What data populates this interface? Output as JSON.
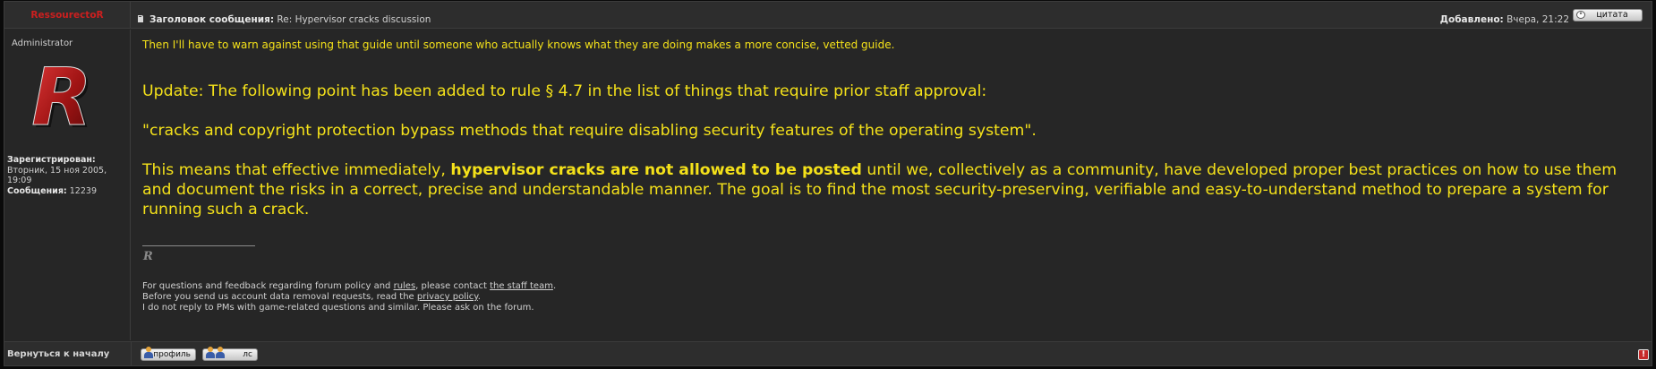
{
  "header": {
    "username": "RessourectoR",
    "subject_label": "Заголовок сообщения:",
    "subject_value": "Re: Hypervisor cracks discussion",
    "added_label": "Добавлено:",
    "added_value": "Вчера, 21:22",
    "quote_label": "цитата"
  },
  "profile": {
    "rank": "Administrator",
    "avatar_letter": "R",
    "registered_label": "Зарегистрирован:",
    "registered_value": "Вторник, 15 ноя 2005, 19:09",
    "posts_label": "Сообщения:",
    "posts_value": "12239"
  },
  "post": {
    "intro": "Then I'll have to warn against using that guide until someone who actually knows what they are doing makes a more concise, vetted guide.",
    "update": "Update: The following point has been added to rule § 4.7 in the list of things that require prior staff approval:",
    "rule_quote": "\"cracks and copyright protection bypass methods that require disabling security features of the operating system\".",
    "meaning_start": "This means that effective immediately, ",
    "meaning_bold": "hypervisor cracks are not allowed to be posted",
    "meaning_end": " until we, collectively as a community, have developed proper best practices on how to use them and document the risks in a correct, precise and understandable manner. The goal is to find the most security-preserving, verifiable and easy-to-understand method to prepare a system for running such a crack."
  },
  "signature": {
    "mark": "R",
    "line1_a": "For questions and feedback regarding forum policy and ",
    "line1_link1": "rules",
    "line1_b": ", please contact ",
    "line1_link2": "the staff team",
    "line1_c": ".",
    "line2_a": "Before you send us account data removal requests, read the ",
    "line2_link": "privacy policy",
    "line2_b": ".",
    "line3": "I do not reply to PMs with game-related questions and similar. Please ask on the forum."
  },
  "bottom": {
    "back_to_top": "Вернуться к началу",
    "profile_button": "профиль",
    "pm_button": "лс",
    "report_symbol": "!"
  },
  "colors": {
    "post_text": "#f4e11a",
    "username": "#cc1f1f",
    "background": "#262626"
  }
}
